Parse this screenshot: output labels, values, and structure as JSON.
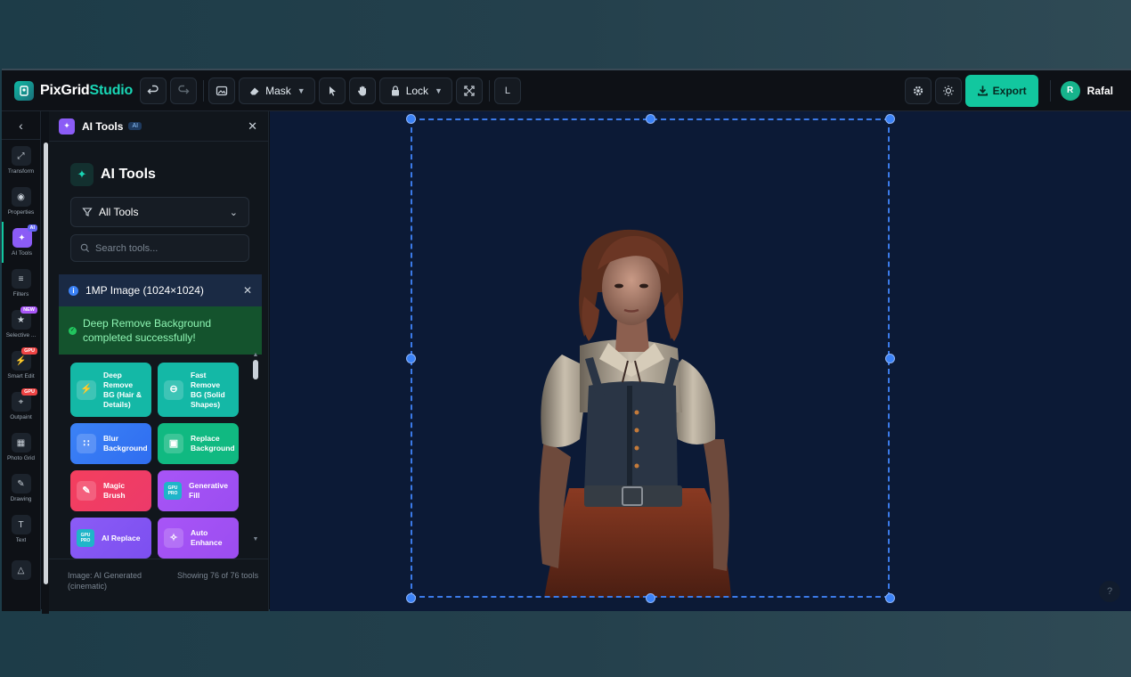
{
  "app": {
    "name_part1": "PixGrid",
    "name_part2": "Studio"
  },
  "toolbar": {
    "mask_label": "Mask",
    "lock_label": "Lock",
    "layer_shortcut": "L",
    "export_label": "Export"
  },
  "user": {
    "initial": "R",
    "name": "Rafal"
  },
  "rail": {
    "items": [
      {
        "label": "Transform"
      },
      {
        "label": "Properties"
      },
      {
        "label": "AI Tools",
        "badge": "AI"
      },
      {
        "label": "Filters"
      },
      {
        "label": "Selective ...",
        "badge": "NEW"
      },
      {
        "label": "Smart Edit",
        "badge": "GPU"
      },
      {
        "label": "Outpaint",
        "badge": "GPU"
      },
      {
        "label": "Photo Grid"
      },
      {
        "label": "Drawing"
      },
      {
        "label": "Text"
      }
    ]
  },
  "panel": {
    "header_title": "AI Tools",
    "header_tag": "AI",
    "title": "AI Tools",
    "filter_value": "All Tools",
    "search_placeholder": "Search tools...",
    "info_text": "1MP Image (1024×1024)",
    "success_line1": "Deep Remove Background",
    "success_line2": "completed successfully!",
    "tools": [
      {
        "label": "Deep Remove BG (Hair & Details)",
        "color": "#14b8a6"
      },
      {
        "label": "Fast Remove BG (Solid Shapes)",
        "color": "#14b8a6"
      },
      {
        "label": "Blur Background",
        "color": "#3b82f6"
      },
      {
        "label": "Replace Background",
        "color": "#10b981"
      },
      {
        "label": "Magic Brush",
        "color": "#f43f5e"
      },
      {
        "label": "Generative Fill",
        "color": "#a855f7",
        "badge": "GPU PRO"
      },
      {
        "label": "AI Replace",
        "color": "#8b5cf6",
        "badge": "GPU PRO"
      },
      {
        "label": "Auto Enhance",
        "color": "#a855f7"
      }
    ],
    "footer_left": "Image: AI Generated (cinematic)",
    "footer_right": "Showing 76 of 76 tools"
  },
  "canvas": {
    "help_label": "?"
  }
}
